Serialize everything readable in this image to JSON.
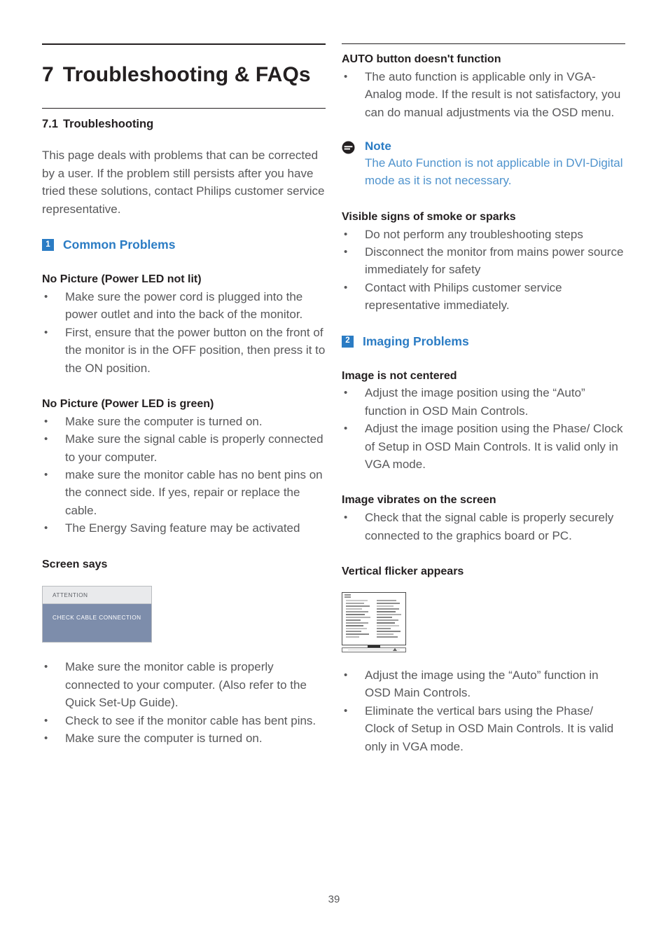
{
  "page": {
    "number": "39"
  },
  "left_column": {
    "chapter": {
      "number": "7",
      "title": "Troubleshooting & FAQs"
    },
    "section": {
      "number": "7.1",
      "title": "Troubleshooting"
    },
    "intro": "This page deals with problems that can be corrected by a user. If the problem still persists after you have tried these solutions, contact Philips customer service representative.",
    "common_problems": {
      "badge": "1",
      "label": "Common Problems"
    },
    "groups": [
      {
        "heading": "No Picture (Power LED not lit)",
        "items": [
          "Make sure the power cord is plugged into the power outlet and into the back of the monitor.",
          "First, ensure that the power button on the front of the monitor is in the OFF position, then press it to the ON position."
        ]
      },
      {
        "heading": "No Picture (Power LED is green)",
        "items": [
          "Make sure the computer is turned on.",
          "Make sure the signal cable is properly connected to your computer.",
          "make sure the monitor cable has no bent pins on the connect side. If yes, repair or replace the cable.",
          "The Energy Saving feature may be activated"
        ]
      }
    ],
    "screen_says": {
      "heading": "Screen says",
      "osd_title": "ATTENTION",
      "osd_message": "CHECK CABLE CONNECTION",
      "items": [
        "Make sure the monitor cable is properly connected to your computer. (Also refer to the Quick Set-Up Guide).",
        "Check to see if the monitor cable has bent pins.",
        "Make sure the computer is turned on."
      ]
    }
  },
  "right_column": {
    "auto_button": {
      "heading": "AUTO button doesn't function",
      "items": [
        "The auto function is applicable only in VGA- Analog mode.  If the result is not satisfactory, you can do manual adjustments via the OSD menu."
      ]
    },
    "note": {
      "icon": "note-circle-icon",
      "title": "Note",
      "body": "The Auto Function is not applicable in DVI-Digital mode as it is not necessary."
    },
    "smoke": {
      "heading": "Visible signs of smoke or sparks",
      "items": [
        "Do not perform any troubleshooting steps",
        "Disconnect the monitor from mains power source immediately for safety",
        "Contact with Philips customer service representative immediately."
      ]
    },
    "imaging_problems": {
      "badge": "2",
      "label": "Imaging Problems"
    },
    "groups": [
      {
        "heading": "Image is not centered",
        "items": [
          "Adjust the image position using the “Auto” function in OSD Main Controls.",
          "Adjust the image position using the Phase/ Clock of Setup in OSD Main Controls.  It is valid only in VGA mode."
        ]
      },
      {
        "heading": "Image vibrates on the screen",
        "items": [
          "Check that the signal cable is properly securely connected to the graphics board or PC."
        ]
      }
    ],
    "vertical_flicker": {
      "heading": "Vertical flicker appears",
      "items": [
        "Adjust the image using the “Auto” function in OSD Main Controls.",
        "Eliminate the vertical bars using the Phase/ Clock of Setup in OSD Main Controls. It is valid only in VGA mode."
      ]
    }
  },
  "colors": {
    "accent_blue": "#2b7cc4",
    "note_blue": "#4f93cd",
    "heading_black": "#231f20",
    "body_gray": "#58585a",
    "osd_body_bg": "#7d8dab",
    "osd_title_bg": "#e9eaec"
  }
}
